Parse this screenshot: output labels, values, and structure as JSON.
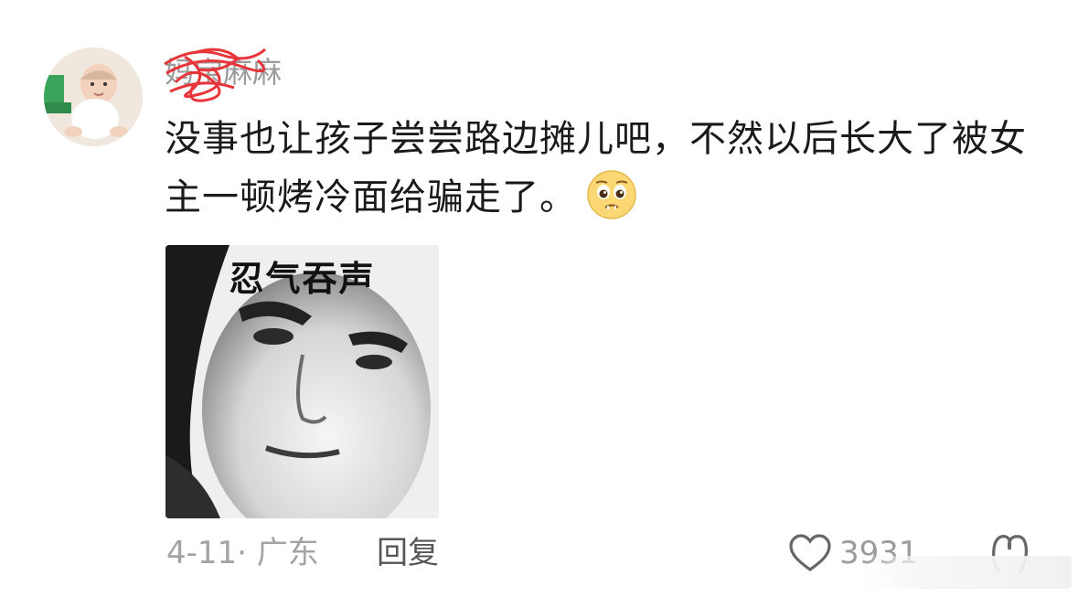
{
  "user": {
    "name": "妈宝麻麻",
    "avatar": "baby-photo"
  },
  "comment": {
    "text": "没事也让孩子尝尝路边摊儿吧，不然以后长大了被女主一顿烤冷面给骗走了。",
    "emoji": "pleading-face-icon"
  },
  "meme": {
    "caption": "忍气吞声"
  },
  "footer": {
    "date_location": "4-11· 广东",
    "reply_label": "回复",
    "like_count": "3931"
  },
  "icons": {
    "like": "heart-icon",
    "more": "comment-more-icon"
  }
}
